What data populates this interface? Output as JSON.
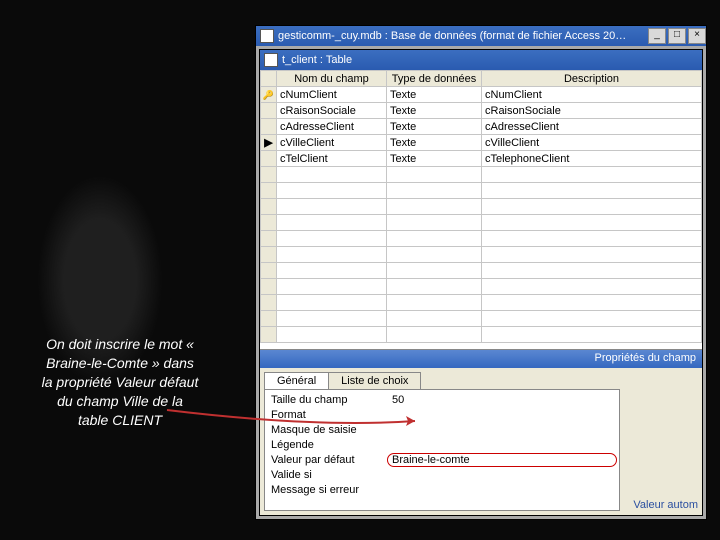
{
  "annotation": "On doit inscrire le mot « Braine-le-Comte » dans la propriété Valeur défaut du champ Ville de la table CLIENT",
  "outer_window": {
    "title": "gesticomm-_cuy.mdb : Base de données (format de fichier Access 20…"
  },
  "inner_window": {
    "title": "t_client : Table"
  },
  "columns": {
    "c1": "Nom du champ",
    "c2": "Type de données",
    "c3": "Description"
  },
  "rows": [
    {
      "marker": "key",
      "name": "cNumClient",
      "type": "Texte",
      "desc": "cNumClient"
    },
    {
      "marker": "",
      "name": "cRaisonSociale",
      "type": "Texte",
      "desc": "cRaisonSociale"
    },
    {
      "marker": "",
      "name": "cAdresseClient",
      "type": "Texte",
      "desc": "cAdresseClient"
    },
    {
      "marker": "cur",
      "name": "cVilleClient",
      "type": "Texte",
      "desc": "cVilleClient"
    },
    {
      "marker": "",
      "name": "cTelClient",
      "type": "Texte",
      "desc": "cTelephoneClient"
    }
  ],
  "blank_row_count": 11,
  "props_caption": "Propriétés du champ",
  "tabs": {
    "general": "Général",
    "lookup": "Liste de choix"
  },
  "properties": [
    {
      "label": "Taille du champ",
      "value": "50",
      "hl": false
    },
    {
      "label": "Format",
      "value": "",
      "hl": false
    },
    {
      "label": "Masque de saisie",
      "value": "",
      "hl": false
    },
    {
      "label": "Légende",
      "value": "",
      "hl": false
    },
    {
      "label": "Valeur par défaut",
      "value": "Braine-le-comte",
      "hl": true
    },
    {
      "label": "Valide si",
      "value": "",
      "hl": false
    },
    {
      "label": "Message si erreur",
      "value": "",
      "hl": false
    }
  ],
  "right_hint": "Valeur autom"
}
